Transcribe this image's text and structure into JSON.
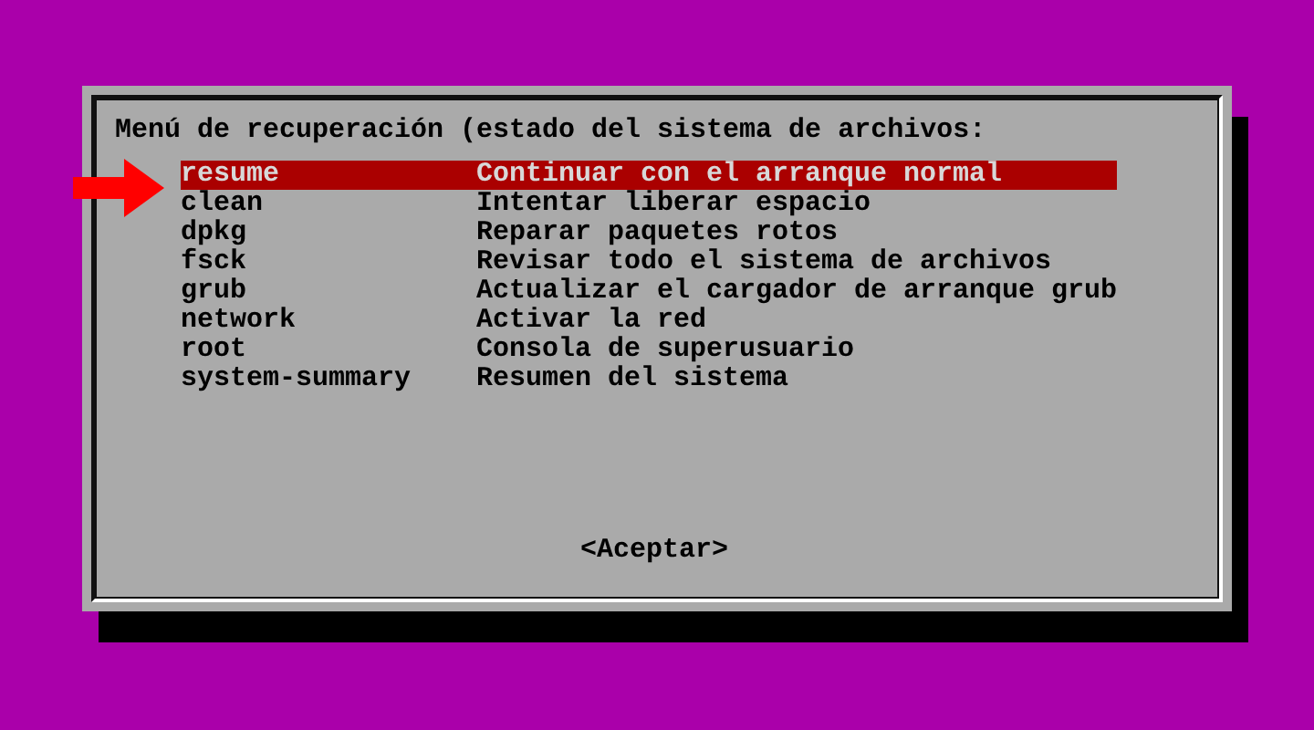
{
  "dialog": {
    "title": "Menú de recuperación (estado del sistema de archivos:",
    "items": [
      {
        "name": "resume",
        "description": "Continuar con el arranque normal",
        "selected": true
      },
      {
        "name": "clean",
        "description": "Intentar liberar espacio",
        "selected": false
      },
      {
        "name": "dpkg",
        "description": "Reparar paquetes rotos",
        "selected": false
      },
      {
        "name": "fsck",
        "description": "Revisar todo el sistema de archivos",
        "selected": false
      },
      {
        "name": "grub",
        "description": "Actualizar el cargador de arranque grub",
        "selected": false
      },
      {
        "name": "network",
        "description": "Activar la red",
        "selected": false
      },
      {
        "name": "root",
        "description": "Consola de superusuario",
        "selected": false
      },
      {
        "name": "system-summary",
        "description": "Resumen del sistema",
        "selected": false
      }
    ],
    "button": "<Aceptar>"
  }
}
